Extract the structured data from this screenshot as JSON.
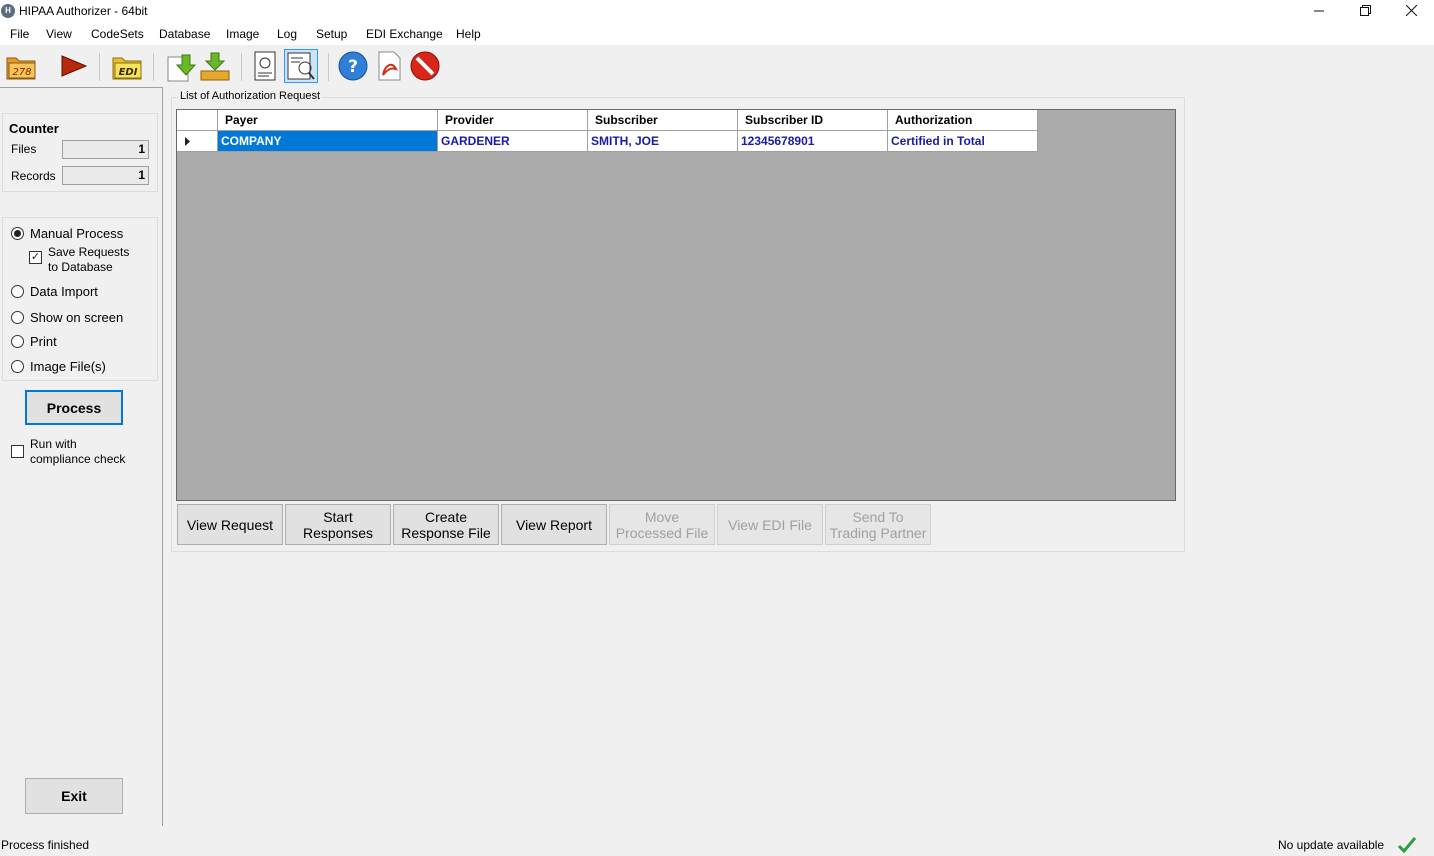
{
  "window": {
    "title": "HIPAA Authorizer - 64bit",
    "app_icon": "app-icon",
    "controls": [
      "minimize-icon",
      "restore-icon",
      "close-icon"
    ]
  },
  "menu": [
    "File",
    "View",
    "CodeSets",
    "Database",
    "Image",
    "Log",
    "Setup",
    "EDI Exchange",
    "Help"
  ],
  "toolbar": {
    "items": [
      {
        "name": "open-278-icon",
        "text": "278"
      },
      {
        "name": "run-icon"
      },
      {
        "name": "open-edi-icon",
        "text": "EDI"
      },
      {
        "name": "import-icon"
      },
      {
        "name": "export-icon"
      },
      {
        "name": "inspect-icon"
      },
      {
        "name": "certificate-icon"
      },
      {
        "name": "help-icon",
        "text": "?"
      },
      {
        "name": "pdf-icon"
      },
      {
        "name": "stop-icon"
      }
    ]
  },
  "counter": {
    "title": "Counter",
    "files_label": "Files",
    "files_value": "1",
    "records_label": "Records",
    "records_value": "1"
  },
  "options": {
    "manual_process": "Manual Process",
    "save_requests_line1": "Save Requests",
    "save_requests_line2": "to Database",
    "data_import": "Data Import",
    "show_on_screen": "Show on screen",
    "print": "Print",
    "image_files": "Image File(s)",
    "selected": "Manual Process",
    "save_checked": true
  },
  "process_button": "Process",
  "compliance": {
    "line1": "Run with",
    "line2": "compliance check",
    "checked": false
  },
  "exit_button": "Exit",
  "main": {
    "group_title": "List of Authorization Request",
    "columns": [
      "Payer",
      "Provider",
      "Subscriber",
      "Subscriber ID",
      "Authorization"
    ],
    "rows": [
      [
        "COMPANY",
        "GARDENER",
        "SMITH, JOE",
        "12345678901",
        "Certified in Total"
      ]
    ]
  },
  "actions": [
    {
      "line1": "View Request",
      "line2": "",
      "enabled": true
    },
    {
      "line1": "Start",
      "line2": "Responses",
      "enabled": true
    },
    {
      "line1": "Create",
      "line2": "Response File",
      "enabled": true
    },
    {
      "line1": "View Report",
      "line2": "",
      "enabled": true
    },
    {
      "line1": "Move",
      "line2": "Processed File",
      "enabled": false
    },
    {
      "line1": "View EDI File",
      "line2": "",
      "enabled": false
    },
    {
      "line1": "Send To",
      "line2": "Trading Partner",
      "enabled": false
    }
  ],
  "status": {
    "left": "Process finished",
    "right": "No update available",
    "icon": "checkmark-icon",
    "icon_color": "#2e9e3e"
  },
  "colors": {
    "selection": "#0078d7",
    "link_text": "#1a1aa8",
    "grid_background": "#ababab"
  }
}
